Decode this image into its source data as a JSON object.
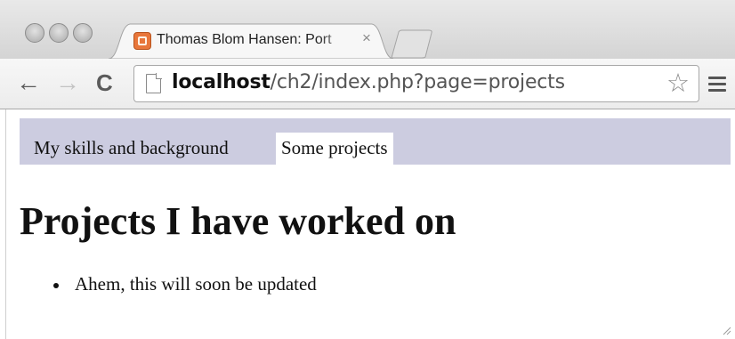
{
  "window": {
    "controls": [
      "close-button",
      "minimize-button",
      "zoom-button"
    ]
  },
  "tabs": [
    {
      "title": "Thomas Blom Hansen: Port",
      "close_glyph": "×",
      "active": true
    }
  ],
  "toolbar": {
    "back_glyph": "←",
    "forward_glyph": "→",
    "reload_glyph": "C",
    "url_host": "localhost",
    "url_path": "/ch2/index.php?page=projects",
    "star_glyph": "☆"
  },
  "page": {
    "nav": [
      {
        "label": "My skills and background",
        "active": false
      },
      {
        "label": "Some projects",
        "active": true
      }
    ],
    "heading": "Projects I have worked on",
    "list": [
      "Ahem, this will soon be updated"
    ]
  },
  "colors": {
    "nav_background": "#cccce0",
    "favicon": "#e8763a"
  }
}
